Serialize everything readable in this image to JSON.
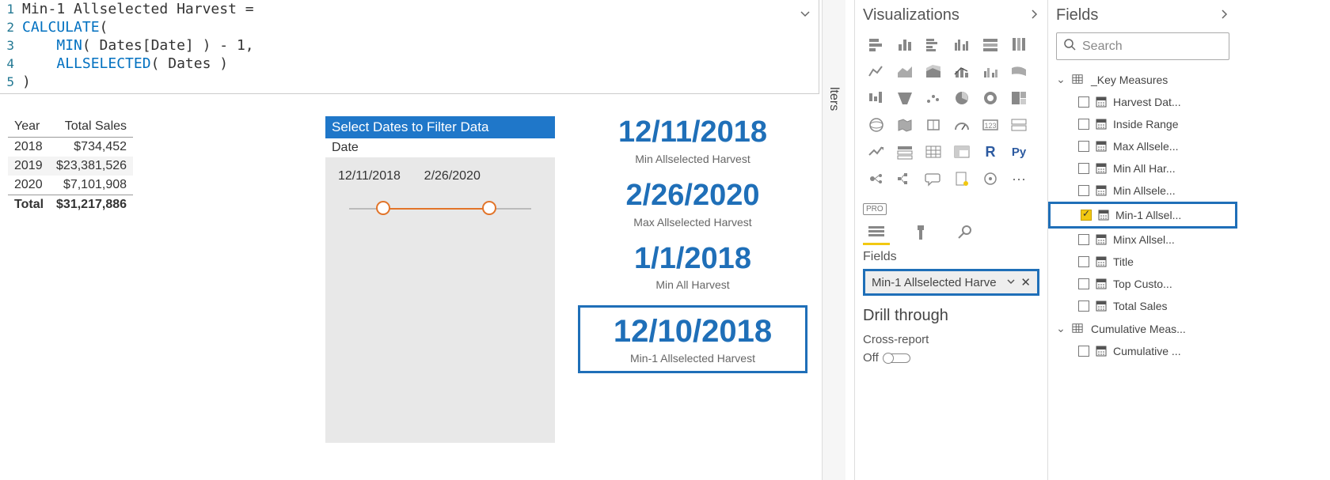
{
  "formula": {
    "lines": [
      {
        "num": "1",
        "prefix": "",
        "plain1": "Min-1 Allselected Harvest ",
        "op": "="
      },
      {
        "num": "2",
        "kw": "CALCULATE",
        "paren": "("
      },
      {
        "num": "3",
        "indent": "    ",
        "fn": "MIN",
        "args": "( Dates[Date] ) - 1,"
      },
      {
        "num": "4",
        "indent": "    ",
        "fn": "ALLSELECTED",
        "args": "( Dates )"
      },
      {
        "num": "5",
        "paren_close": ")"
      }
    ]
  },
  "sales": {
    "headers": [
      "Year",
      "Total Sales"
    ],
    "rows": [
      {
        "year": "2018",
        "value": "$734,452"
      },
      {
        "year": "2019",
        "value": "$23,381,526"
      },
      {
        "year": "2020",
        "value": "$7,101,908"
      }
    ],
    "total_label": "Total",
    "total_value": "$31,217,886"
  },
  "slicer": {
    "title": "Select Dates to Filter Data",
    "field": "Date",
    "start": "12/11/2018",
    "end": "2/26/2020"
  },
  "cards": [
    {
      "value": "12/11/2018",
      "label": "Min Allselected Harvest"
    },
    {
      "value": "2/26/2020",
      "label": "Max Allselected Harvest"
    },
    {
      "value": "1/1/2018",
      "label": "Min All Harvest"
    },
    {
      "value": "12/10/2018",
      "label": "Min-1 Allselected Harvest"
    }
  ],
  "filters_tab": "lters",
  "viz_pane": {
    "title": "Visualizations",
    "fields_label": "Fields",
    "well_value": "Min-1 Allselected Harve",
    "drill_title": "Drill through",
    "cross_report": "Cross-report",
    "toggle_label": "Off",
    "r_label": "R",
    "py_label": "Py",
    "more": "···",
    "pro": "PRO"
  },
  "fields_pane": {
    "title": "Fields",
    "search_placeholder": "Search",
    "groups": [
      {
        "name": "_Key Measures",
        "expanded": true,
        "items": [
          {
            "label": "Harvest Dat...",
            "checked": false
          },
          {
            "label": "Inside Range",
            "checked": false
          },
          {
            "label": "Max Allsele...",
            "checked": false
          },
          {
            "label": "Min All Har...",
            "checked": false
          },
          {
            "label": "Min Allsele...",
            "checked": false
          },
          {
            "label": "Min-1 Allsel...",
            "checked": true,
            "selected": true
          },
          {
            "label": "Minx Allsel...",
            "checked": false
          },
          {
            "label": "Title",
            "checked": false
          },
          {
            "label": "Top Custo...",
            "checked": false
          },
          {
            "label": "Total Sales",
            "checked": false
          }
        ]
      },
      {
        "name": "Cumulative Meas...",
        "expanded": true,
        "items": [
          {
            "label": "Cumulative ...",
            "checked": false
          }
        ]
      }
    ]
  }
}
